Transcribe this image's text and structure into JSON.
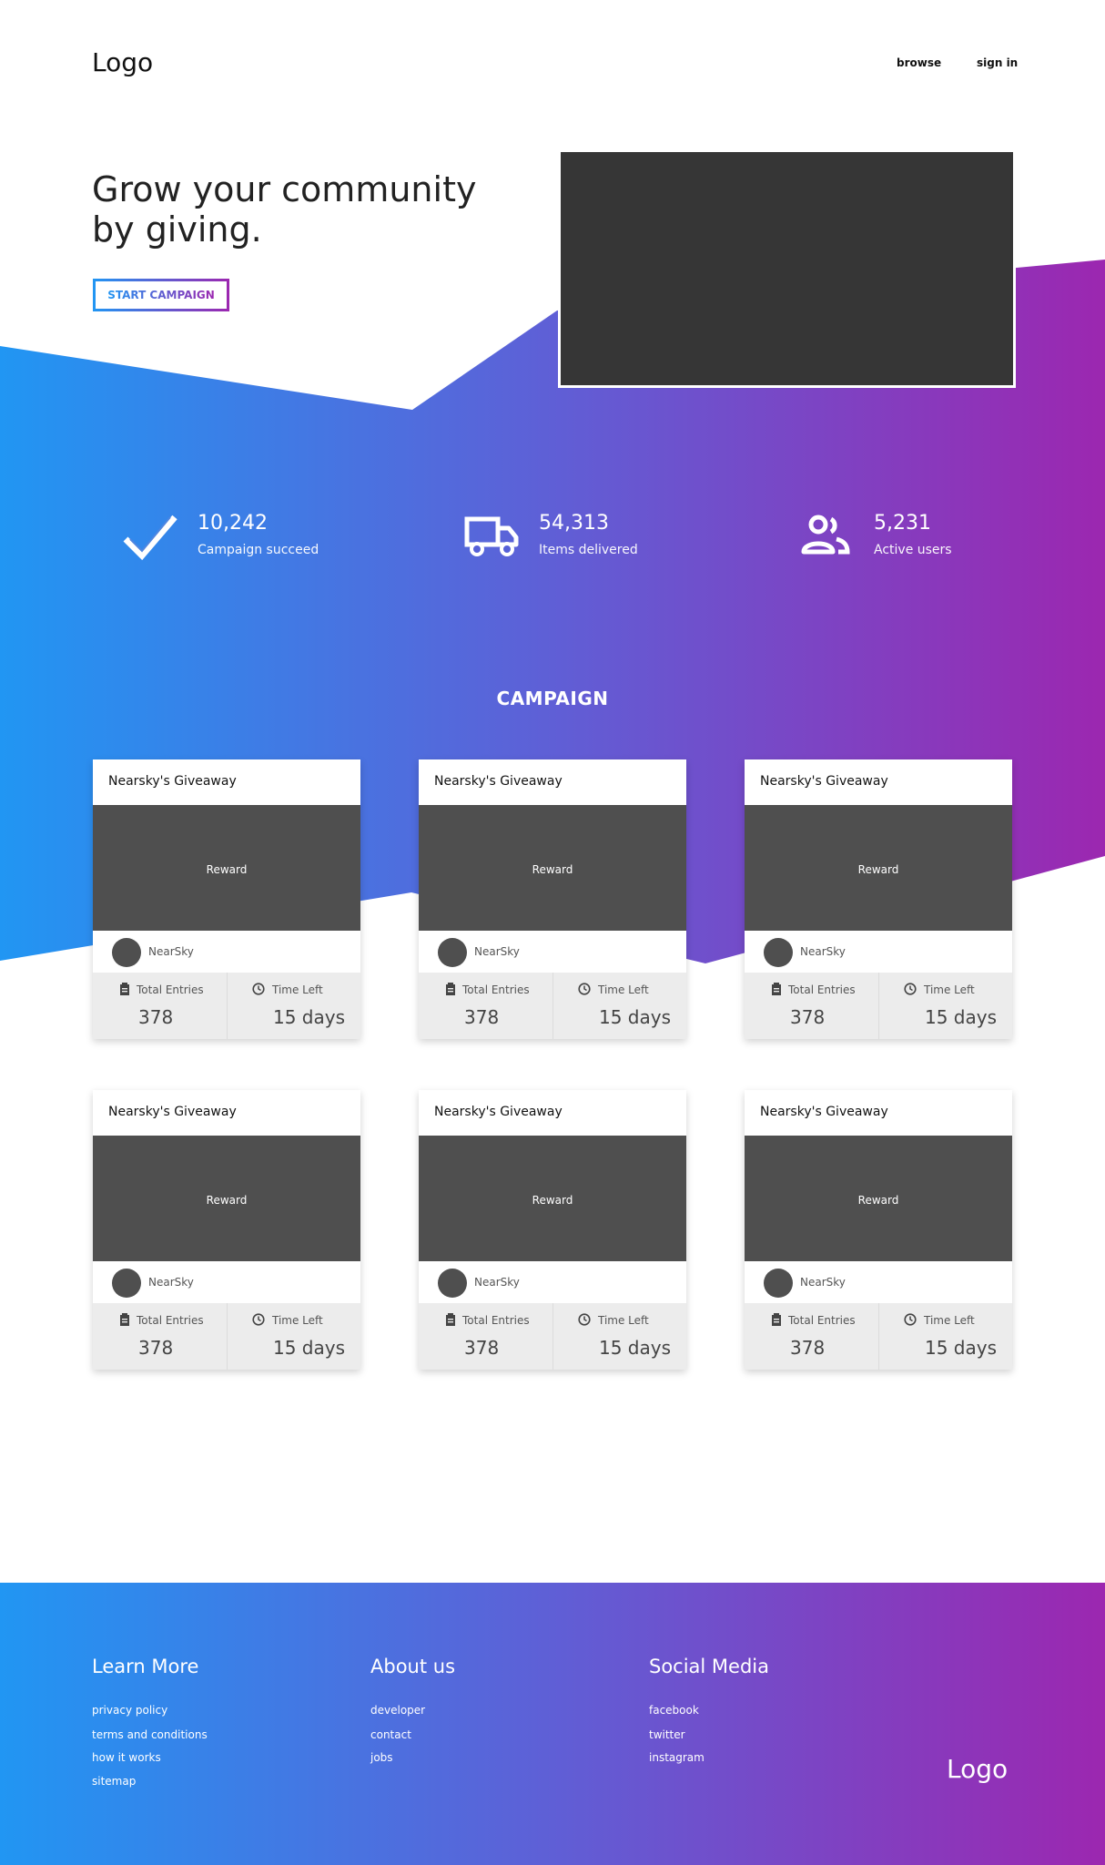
{
  "header": {
    "logo": "Logo",
    "nav": [
      "browse",
      "sign in"
    ]
  },
  "hero": {
    "title_line1": "Grow your community",
    "title_line2": "by giving.",
    "cta_label": "START CAMPAIGN"
  },
  "colors": {
    "gradient_start": "#2196f3",
    "gradient_end": "#9c27b0",
    "video_placeholder": "#363636",
    "card_media": "#4f4f4f"
  },
  "stats": [
    {
      "value": "10,242",
      "label": "Campaign succeed",
      "icon": "checkmark-icon"
    },
    {
      "value": "54,313",
      "label": "Items delivered",
      "icon": "truck-icon"
    },
    {
      "value": "5,231",
      "label": "Active users",
      "icon": "users-icon"
    }
  ],
  "campaign": {
    "section_title": "CAMPAIGN",
    "cards": [
      {
        "title": "Nearsky's Giveaway",
        "reward": "Reward",
        "user": "NearSky",
        "entries_label": "Total Entries",
        "entries": "378",
        "time_label": "Time Left",
        "time": "15 days"
      },
      {
        "title": "Nearsky's Giveaway",
        "reward": "Reward",
        "user": "NearSky",
        "entries_label": "Total Entries",
        "entries": "378",
        "time_label": "Time Left",
        "time": "15 days"
      },
      {
        "title": "Nearsky's Giveaway",
        "reward": "Reward",
        "user": "NearSky",
        "entries_label": "Total Entries",
        "entries": "378",
        "time_label": "Time Left",
        "time": "15 days"
      },
      {
        "title": "Nearsky's Giveaway",
        "reward": "Reward",
        "user": "NearSky",
        "entries_label": "Total Entries",
        "entries": "378",
        "time_label": "Time Left",
        "time": "15 days"
      },
      {
        "title": "Nearsky's Giveaway",
        "reward": "Reward",
        "user": "NearSky",
        "entries_label": "Total Entries",
        "entries": "378",
        "time_label": "Time Left",
        "time": "15 days"
      },
      {
        "title": "Nearsky's Giveaway",
        "reward": "Reward",
        "user": "NearSky",
        "entries_label": "Total Entries",
        "entries": "378",
        "time_label": "Time Left",
        "time": "15 days"
      }
    ]
  },
  "footer": {
    "columns": [
      {
        "heading": "Learn More",
        "links": [
          "privacy policy",
          "terms and conditions",
          "how it works",
          "sitemap"
        ]
      },
      {
        "heading": "About us",
        "links": [
          "developer",
          "contact",
          "jobs"
        ]
      },
      {
        "heading": "Social Media",
        "links": [
          "facebook",
          "twitter",
          "instagram"
        ]
      }
    ],
    "logo": "Logo"
  }
}
